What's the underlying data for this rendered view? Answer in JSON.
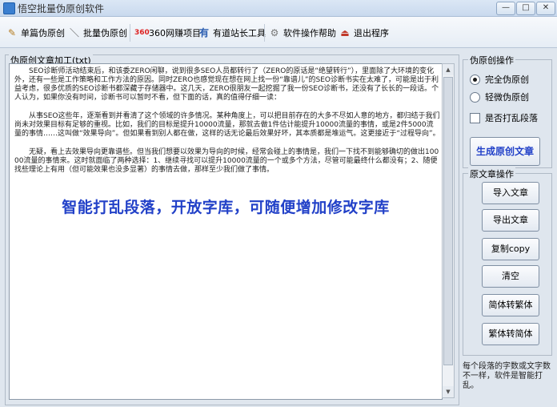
{
  "window": {
    "title": "悟空批量伪原创软件",
    "controls": {
      "minimize": "—",
      "maximize": "□",
      "close": "✕"
    }
  },
  "toolbar": {
    "items": [
      {
        "label": "单篇伪原创",
        "icon": "single-article-icon"
      },
      {
        "label": "批量伪原创",
        "icon": "batch-wand-icon"
      },
      {
        "label": "360网赚项目",
        "icon": "project-360-icon"
      },
      {
        "label": "有道站长工具",
        "icon": "webmaster-tool-icon"
      },
      {
        "label": "软件操作帮助",
        "icon": "gear-help-icon"
      },
      {
        "label": "退出程序",
        "icon": "exit-icon"
      }
    ]
  },
  "editor": {
    "label": "伪原创文章加工(txt)",
    "paragraphs": [
      "SEO诊断师活动结束后，和该委ZERO闲聊，说到很多SEO人员都转行了（ZERO的原话是“绝望转行”），里面除了大环境的变化外，还有一些是工作策略和工作方法的原因。同时ZERO也感觉现在想在网上找一份“靠谱儿”的SEO诊断书实在太难了，可能是出于利益考虑，很多优质的SEO诊断书都深藏于存储器中。这几天，ZERO很朋友一起挖掘了我一份SEO诊断书，还没有了长长的一段话。个人认为，如果你没有时间，诊断书可以暂时不看，但下面的话，真的值得仔细一读：",
      "从事SEO这些年，逐渐看到并看清了这个领域的许多情况。某种角度上，可以把目前存在的大多不尽如人意的地方，都归结于我们尚未对效果目标有足够的重视。比如，我们的目标是提升10000流量，那就去做1件估计能提升10000流量的事情，或是2件5000流量的事情……这叫做“效果导向”。但如果看到别人都在做，这样的话无论最后效果好坏，其本质都是堆运气。这更接近于“过程导向”。",
      "无疑，看上去效果导向更靠谱些。但当我们想要以效果为导向的时候，经常会碰上的事情是，我们一下找不到能够确切的做出10000流量的事情来。这时就面临了两种选择：1、继续寻找可以提升10000流量的一个或多个方法，尽管可能最终什么都没有；2、随便找些理论上有用（但可能效果也没多显著）的事情去做，那样至少我们做了事情。"
    ],
    "overlay": "智能打乱段落，开放字库，可随便增加修改字库",
    "scrollbar": {
      "up": "▲",
      "down": "▼"
    }
  },
  "rewrite_ops": {
    "title": "伪原创操作",
    "options": [
      {
        "label": "完全伪原创",
        "checked": true
      },
      {
        "label": "轻微伪原创",
        "checked": false
      }
    ],
    "shuffle_label": "是否打乱段落",
    "generate_label": "生成原创文章"
  },
  "article_ops": {
    "title": "原文章操作",
    "buttons": [
      "导入文章",
      "导出文章",
      "复制copy",
      "清空",
      "简体转繁体",
      "繁体转简体"
    ]
  },
  "footnote": "每个段落的字数或文字数不一样，软件是智能打乱。",
  "colors": {
    "accent": "#2241c8",
    "background": "#dfe6ee"
  }
}
